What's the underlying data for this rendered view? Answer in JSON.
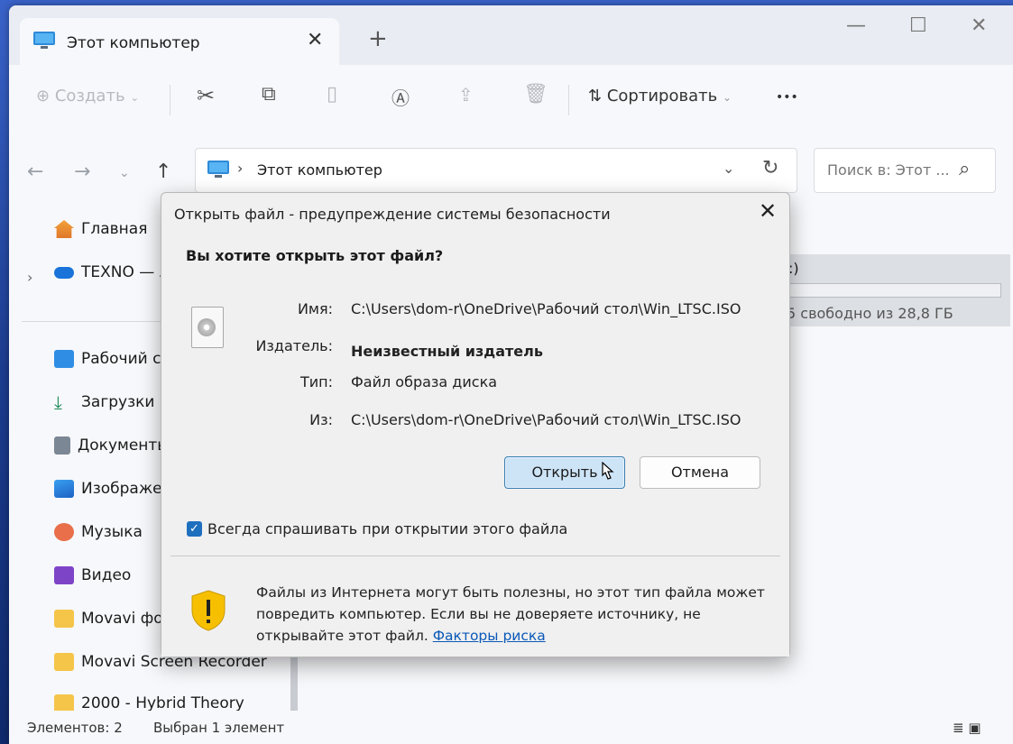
{
  "window": {
    "tab_title": "Этот компьютер",
    "new_tab": "+",
    "minimize": "—",
    "maximize": "☐",
    "close": "✕"
  },
  "toolbar": {
    "create_label": "Создать",
    "sort_label": "Сортировать",
    "more_label": "•••"
  },
  "addressbar": {
    "crumb": "Этот компьютер",
    "search_placeholder": "Поиск в: Этот ..."
  },
  "sidebar": {
    "items": [
      {
        "label": "Главная",
        "icon": "home-icon"
      },
      {
        "label": "TEXNO — Л",
        "icon": "onedrive-icon"
      },
      {
        "label": "Рабочий с",
        "icon": "desktop-folder-icon"
      },
      {
        "label": "Загрузки",
        "icon": "downloads-icon"
      },
      {
        "label": "Документы",
        "icon": "documents-icon"
      },
      {
        "label": "Изображе",
        "icon": "pictures-icon"
      },
      {
        "label": "Музыка",
        "icon": "music-icon"
      },
      {
        "label": "Видео",
        "icon": "videos-icon"
      },
      {
        "label": "Movavi фо",
        "icon": "folder-icon"
      },
      {
        "label": "Movavi Screen Recorder",
        "icon": "folder-icon"
      },
      {
        "label": "2000 - Hybrid Theory",
        "icon": "folder-icon"
      }
    ]
  },
  "content": {
    "drive_name_fragment": ":)",
    "drive_free_fragment": "5 свободно из 28,8 ГБ"
  },
  "statusbar": {
    "items_count": "Элементов: 2",
    "selected": "Выбран 1 элемент"
  },
  "dialog": {
    "title": "Открыть файл - предупреждение системы безопасности",
    "question": "Вы хотите открыть этот файл?",
    "name_label": "Имя:",
    "name_value": "C:\\Users\\dom-r\\OneDrive\\Рабочий стол\\Win_LTSC.ISO",
    "publisher_label": "Издатель:",
    "publisher_value": "Неизвестный издатель",
    "type_label": "Тип:",
    "type_value": "Файл образа диска",
    "from_label": "Из:",
    "from_value": "C:\\Users\\dom-r\\OneDrive\\Рабочий стол\\Win_LTSC.ISO",
    "open_button": "Открыть",
    "cancel_button": "Отмена",
    "always_ask": "Всегда спрашивать при открытии этого файла",
    "always_ask_checked": true,
    "warning_text": "Файлы из Интернета могут быть полезны, но этот тип файла может повредить компьютер. Если вы не доверяете источнику, не открывайте этот файл. ",
    "risk_link": "Факторы риска"
  },
  "colors": {
    "accent": "#1f6fbf",
    "link": "#0a58b8",
    "shield_yellow": "#f6c000"
  }
}
